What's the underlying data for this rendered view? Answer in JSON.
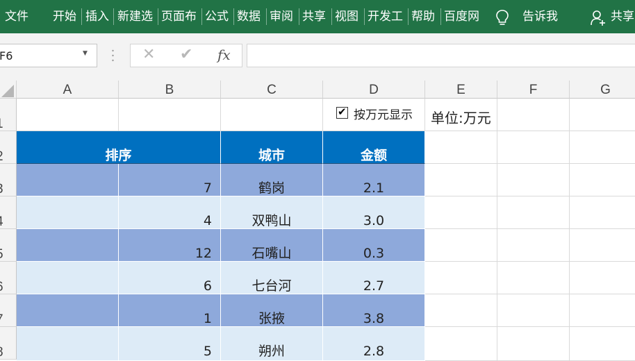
{
  "ribbon": {
    "tabs": [
      "文件",
      "开始",
      "插入",
      "新建选",
      "页面布",
      "公式",
      "数据",
      "审阅",
      "共享",
      "视图",
      "开发工",
      "帮助",
      "百度网"
    ],
    "tell_me": "告诉我",
    "share": "共享",
    "bg_color": "#217346"
  },
  "formula_bar": {
    "name_box": "F6",
    "cancel_symbol": "✕",
    "enter_symbol": "✔",
    "fx_label": "fx",
    "formula": ""
  },
  "sheet": {
    "columns": [
      "A",
      "B",
      "C",
      "D",
      "E",
      "F",
      "G"
    ],
    "rows": [
      "1",
      "2",
      "3",
      "4",
      "5",
      "6",
      "7",
      "8"
    ],
    "checkbox_label": "按万元显示",
    "checkbox_checked": true,
    "unit_label": "单位:万元",
    "table_header": {
      "rank": "排序",
      "city": "城市",
      "amount": "金额"
    },
    "table_rows": [
      {
        "rank": "7",
        "city": "鹤岗",
        "amount": "2.1",
        "stars": ""
      },
      {
        "rank": "4",
        "city": "双鸭山",
        "amount": "3.0",
        "stars": ""
      },
      {
        "rank": "12",
        "city": "石嘴山",
        "amount": "0.3",
        "stars": ""
      },
      {
        "rank": "6",
        "city": "七台河",
        "amount": "2.7",
        "stars": ""
      },
      {
        "rank": "1",
        "city": "张掖",
        "amount": "3.8",
        "stars": "★★★"
      },
      {
        "rank": "5",
        "city": "朔州",
        "amount": "2.8",
        "stars": ""
      }
    ],
    "colors": {
      "header": "#0070c0",
      "band_dark": "#8ea9db",
      "band_light": "#ddebf7",
      "star": "#b00000"
    }
  }
}
